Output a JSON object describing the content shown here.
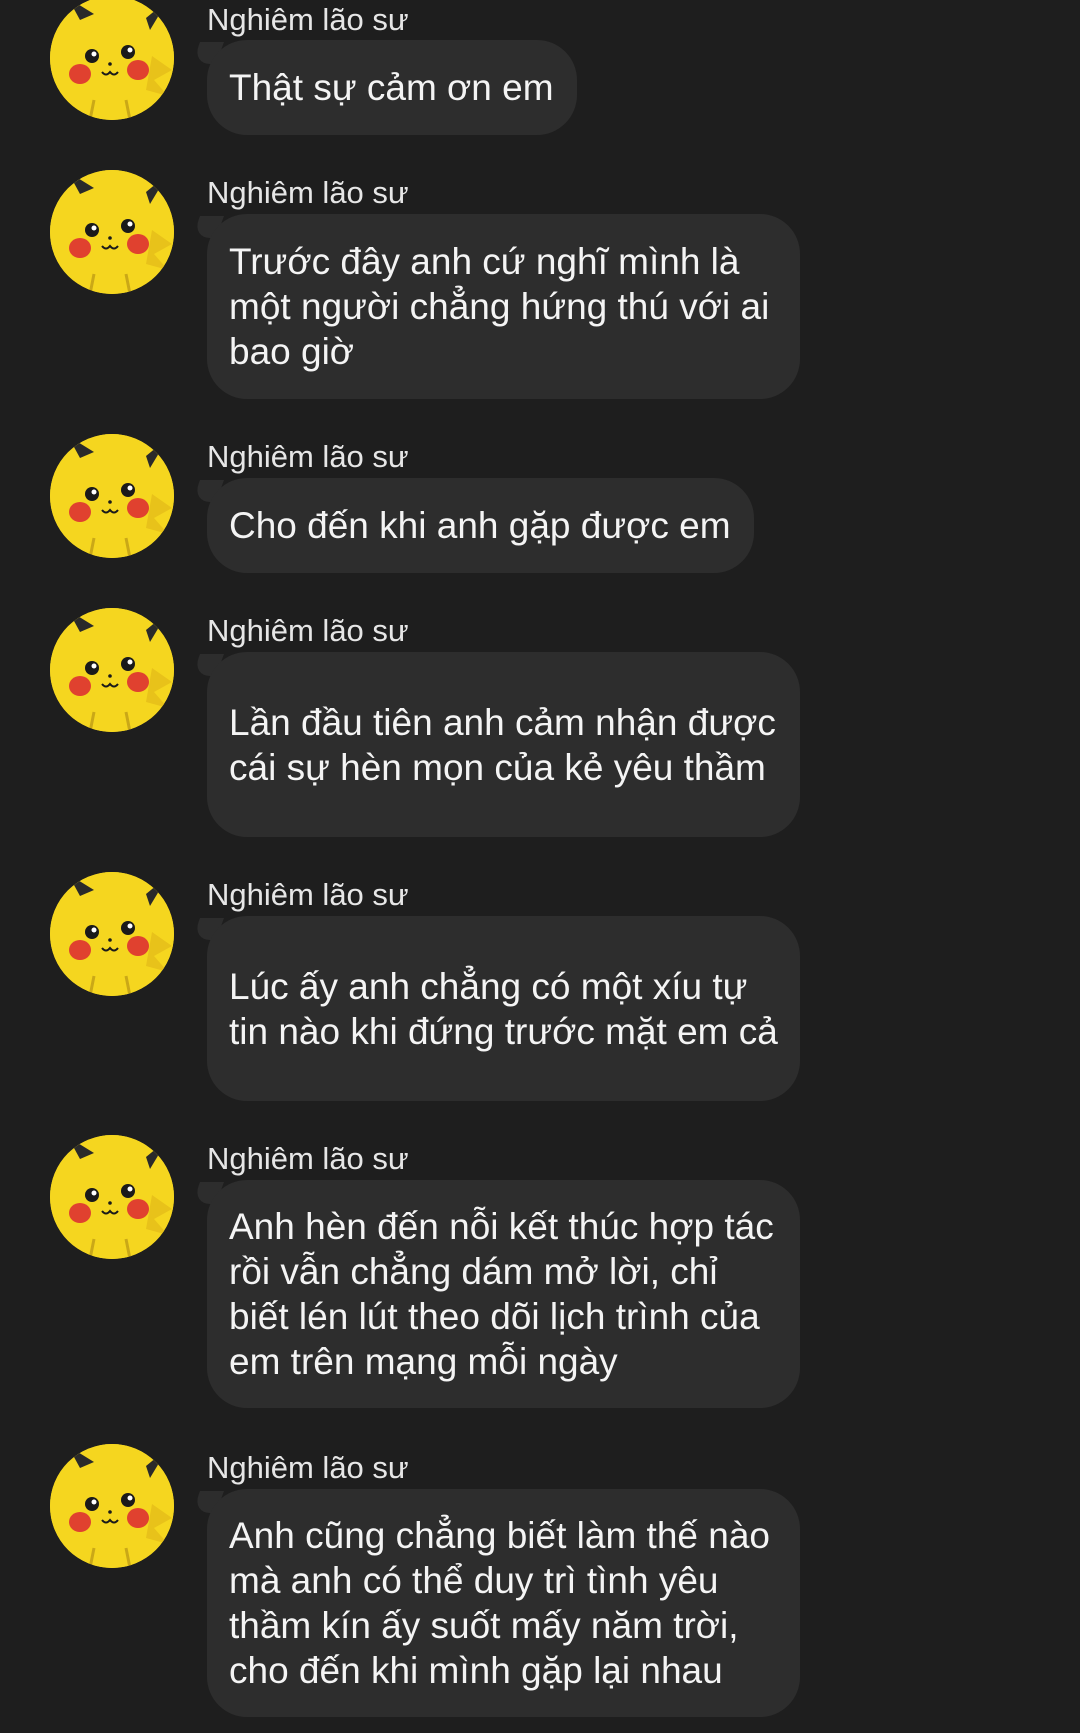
{
  "messages": [
    {
      "sender": "Nghiêm lão sư",
      "avatar_icon": "pikachu-avatar-icon",
      "text": "Thật sự cảm ơn em"
    },
    {
      "sender": "Nghiêm lão sư",
      "avatar_icon": "pikachu-avatar-icon",
      "text": "Trước đây anh cứ nghĩ mình là một người chẳng hứng thú với ai bao giờ"
    },
    {
      "sender": "Nghiêm lão sư",
      "avatar_icon": "pikachu-avatar-icon",
      "text": "Cho đến khi anh gặp được em"
    },
    {
      "sender": "Nghiêm lão sư",
      "avatar_icon": "pikachu-avatar-icon",
      "text": "Lần đầu tiên anh cảm nhận được cái sự hèn mọn của kẻ yêu thầm"
    },
    {
      "sender": "Nghiêm lão sư",
      "avatar_icon": "pikachu-avatar-icon",
      "text": "Lúc ấy anh chẳng có một xíu tự tin nào khi đứng trước mặt em cả"
    },
    {
      "sender": "Nghiêm lão sư",
      "avatar_icon": "pikachu-avatar-icon",
      "text": "Anh hèn đến nỗi kết thúc hợp tác rồi vẫn chẳng dám mở lời, chỉ biết lén lút theo dõi lịch trình của em trên mạng mỗi ngày"
    },
    {
      "sender": "Nghiêm lão sư",
      "avatar_icon": "pikachu-avatar-icon",
      "text": "Anh cũng chẳng biết làm thế nào mà anh có thể duy trì tình yêu thầm kín ấy suốt mấy năm trời, cho đến khi mình gặp lại nhau"
    }
  ],
  "colors": {
    "background": "#1e1e1e",
    "bubble": "#2d2d2d",
    "avatar": "#f5d61f"
  }
}
